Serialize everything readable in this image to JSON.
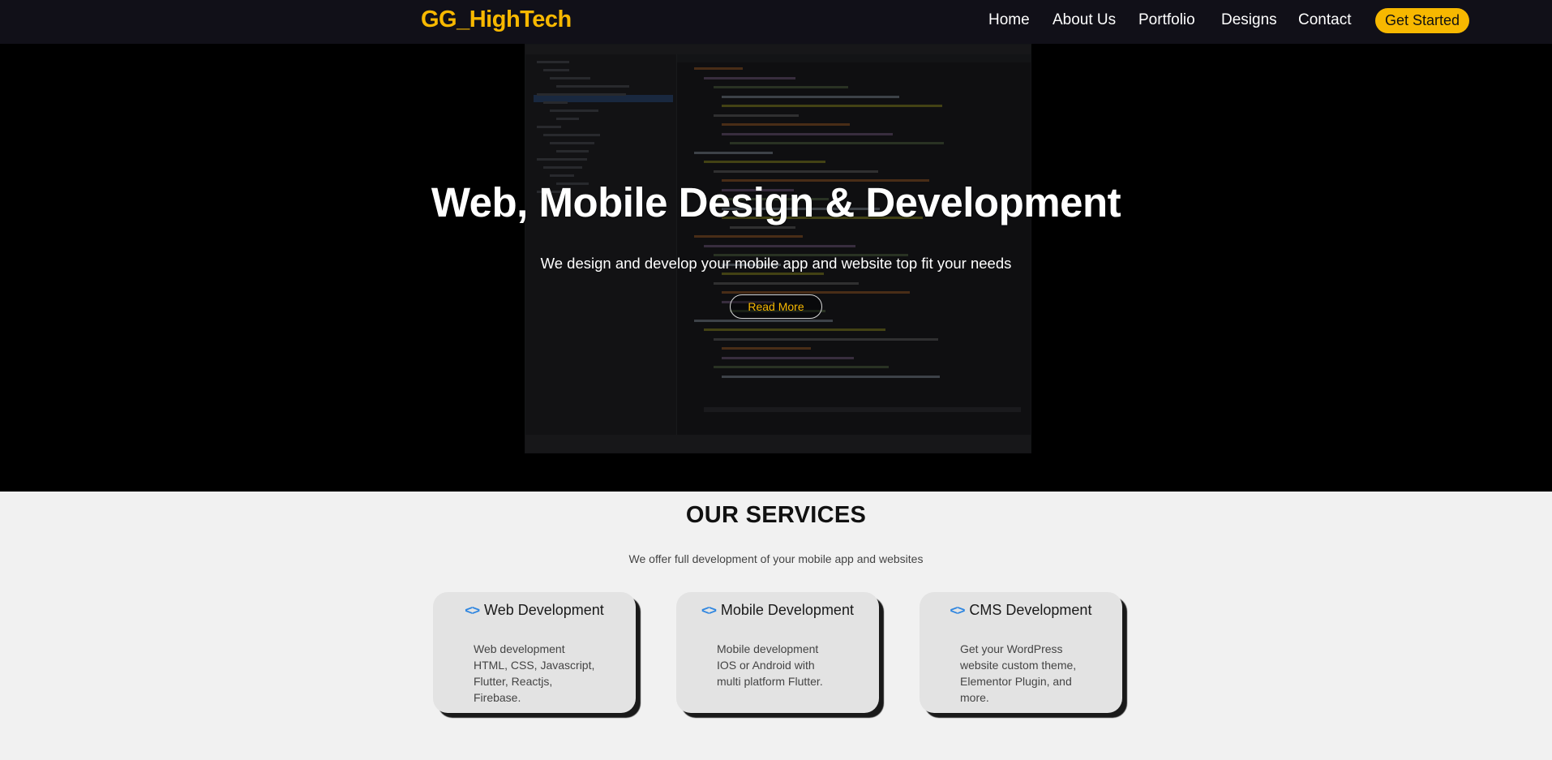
{
  "nav": {
    "brand": "GG_HighTech",
    "links": [
      "Home",
      "About Us",
      "Portfolio",
      "Designs",
      "Contact"
    ],
    "cta": "Get Started",
    "accent_color": "#f7b800"
  },
  "hero": {
    "title": "Web, Mobile Design & Development",
    "subtitle": "We design and develop your mobile app and website top fit your needs",
    "button": "Read More",
    "background_image": "IDE code editor screenshot (dimmed)"
  },
  "services": {
    "title": "OUR SERVICES",
    "subtitle": "We offer full development of your mobile app and websites",
    "icon": "code-brackets-icon",
    "cards": [
      {
        "title": "Web Development",
        "lines": [
          "Web development",
          "HTML, CSS, Javascript,",
          "Flutter, Reactjs,",
          "Firebase."
        ]
      },
      {
        "title": "Mobile Development",
        "lines": [
          "Mobile development",
          "IOS or Android with",
          "multi platform Flutter."
        ]
      },
      {
        "title": "CMS Development",
        "lines": [
          "Get your WordPress",
          "website custom theme,",
          "Elementor Plugin,  and",
          "more."
        ]
      }
    ]
  }
}
